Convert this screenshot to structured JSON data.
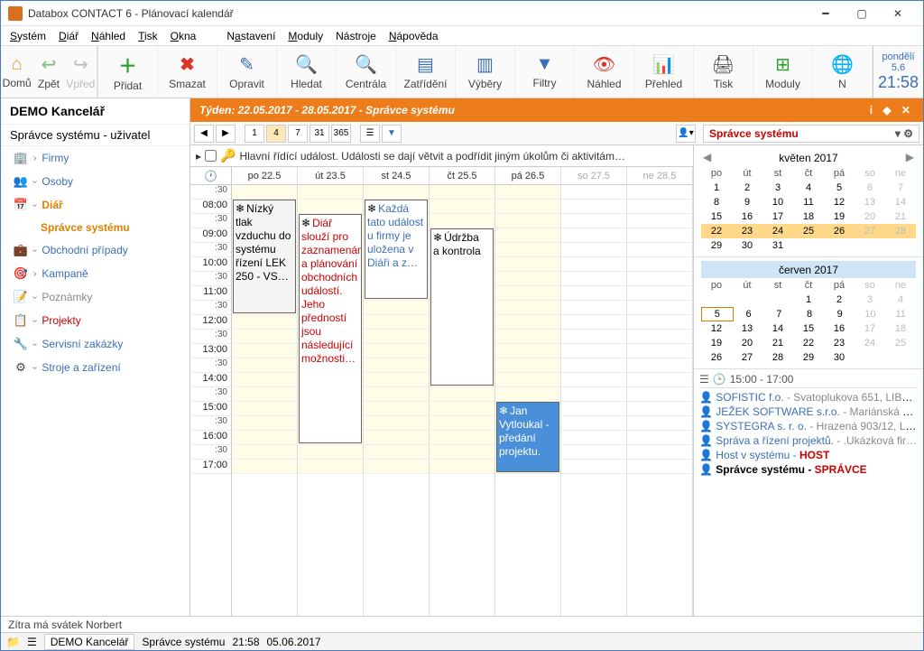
{
  "window": {
    "title": "Databox CONTACT 6 - Plánovací kalendář"
  },
  "menu": {
    "items": [
      "Systém",
      "Diář",
      "Náhled",
      "Tisk",
      "Okna",
      "Nastavení",
      "Moduly",
      "Nástroje",
      "Nápověda"
    ]
  },
  "nav": {
    "home": "Domů",
    "back": "Zpět",
    "fwd": "Vpřed"
  },
  "tools": {
    "add": "Přidat",
    "del": "Smazat",
    "edit": "Opravit",
    "find": "Hledat",
    "central": "Centrála",
    "class": "Zatřídění",
    "select": "Výběry",
    "filter": "Filtry",
    "view": "Náhled",
    "overview": "Přehled",
    "print": "Tisk",
    "modules": "Moduly",
    "n": "N"
  },
  "clock": {
    "day": "pondělí",
    "date": "5.6",
    "time": "21:58"
  },
  "sidebar": {
    "header": "DEMO Kancelář",
    "subtitle": "Správce systému - uživatel",
    "items": [
      {
        "label": "Firmy"
      },
      {
        "label": "Osoby"
      },
      {
        "label": "Diář"
      },
      {
        "label": "Správce systému"
      },
      {
        "label": "Obchodní případy"
      },
      {
        "label": "Kampaně"
      },
      {
        "label": "Poznámky"
      },
      {
        "label": "Projekty"
      },
      {
        "label": "Servisní zakázky"
      },
      {
        "label": "Stroje a zařízení"
      }
    ]
  },
  "header": {
    "title": "Týden: 22.05.2017 - 28.05.2017 - Správce systému"
  },
  "userSelect": {
    "value": "Správce systému"
  },
  "infoRow": {
    "text": "Hlavní řídící událost. Události se dají větvit a podřídit jiným úkolům či aktivitám…"
  },
  "days": {
    "mon": "po 22.5",
    "tue": "út 23.5",
    "wed": "st 24.5",
    "thu": "čt 25.5",
    "fri": "pá 26.5",
    "sat": "so 27.5",
    "sun": "ne 28.5"
  },
  "times": [
    ":30",
    "08:00",
    ":30",
    "09:00",
    ":30",
    "10:00",
    ":30",
    "11:00",
    ":30",
    "12:00",
    ":30",
    "13:00",
    ":30",
    "14:00",
    ":30",
    "15:00",
    ":30",
    "16:00",
    ":30",
    "17:00"
  ],
  "events": {
    "mon": {
      "title": "Nízký",
      "body": "tlak vzduchu do systému řízení LEK 250 - VS…"
    },
    "tue": {
      "title": "Diář",
      "body": "slouží pro zaznamenání a plánování obchodních událostí. Jeho předností jsou následující možnosti…"
    },
    "wed": {
      "title": "Každá",
      "body": "tato událost u firmy je uložena v Diáři a z…"
    },
    "thu": {
      "title": "Údržba",
      "body": "a kontrola"
    },
    "fri": {
      "title": "Jan",
      "body": "Vytloukal - předání projektu."
    }
  },
  "miniCal1": {
    "title": "květen 2017",
    "dow": [
      "po",
      "út",
      "st",
      "čt",
      "pá",
      "so",
      "ne"
    ],
    "rows": [
      [
        "1",
        "2",
        "3",
        "4",
        "5",
        "6",
        "7"
      ],
      [
        "8",
        "9",
        "10",
        "11",
        "12",
        "13",
        "14"
      ],
      [
        "15",
        "16",
        "17",
        "18",
        "19",
        "20",
        "21"
      ],
      [
        "22",
        "23",
        "24",
        "25",
        "26",
        "27",
        "28"
      ],
      [
        "29",
        "30",
        "31",
        "",
        "",
        "",
        ""
      ]
    ]
  },
  "miniCal2": {
    "title": "červen 2017",
    "dow": [
      "po",
      "út",
      "st",
      "čt",
      "pá",
      "so",
      "ne"
    ],
    "rows": [
      [
        "",
        "",
        "",
        "1",
        "2",
        "3",
        "4"
      ],
      [
        "5",
        "6",
        "7",
        "8",
        "9",
        "10",
        "11"
      ],
      [
        "12",
        "13",
        "14",
        "15",
        "16",
        "17",
        "18"
      ],
      [
        "19",
        "20",
        "21",
        "22",
        "23",
        "24",
        "25"
      ],
      [
        "26",
        "27",
        "28",
        "29",
        "30",
        "",
        ""
      ]
    ]
  },
  "tasks": {
    "time": "15:00 - 17:00",
    "items": [
      {
        "a": "SOFISTIC f.o.",
        "b": " - Svatoplukova 651, LIBER…"
      },
      {
        "a": "JEŽEK SOFTWARE s.r.o.",
        "b": " - Mariánská 323…"
      },
      {
        "a": "SYSTEGRA s. r. o.",
        "b": " - Hrazená 903/12, Libe…"
      },
      {
        "a": "Správa a řízení projektů.",
        "b": " - .Ukázková fir…"
      },
      {
        "a": "Host v systému - ",
        "r": "HOST"
      },
      {
        "a": "Správce systému - ",
        "r": "SPRÁVCE",
        "bold": true
      }
    ]
  },
  "status": {
    "text": "Zítra má svátek Norbert"
  },
  "taskbar": {
    "office": "DEMO Kancelář",
    "user": "Správce systému",
    "time": "21:58",
    "date": "05.06.2017"
  }
}
